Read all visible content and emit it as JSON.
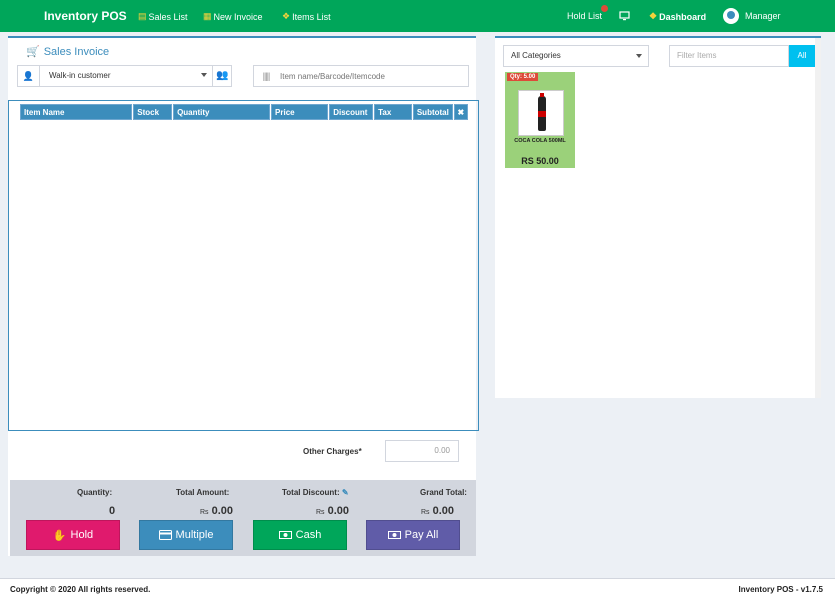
{
  "nav": {
    "brand": "Inventory POS",
    "sales_list": "Sales List",
    "new_invoice": "New Invoice",
    "items_list": "Items List",
    "hold_list": "Hold List",
    "dashboard": "Dashboard",
    "user": "Manager",
    "colors": {
      "bar": "#00a65a",
      "icon": "#f6d33c"
    }
  },
  "invoice": {
    "title": "Sales Invoice",
    "customer": "Walk-in customer",
    "search_placeholder": "Item name/Barcode/Itemcode",
    "columns": [
      "Item Name",
      "Stock",
      "Quantity",
      "Price",
      "Discount",
      "Tax",
      "Subtotal",
      "✖"
    ],
    "other_charges_label": "Other Charges*",
    "other_charges_value": "0.00"
  },
  "totals": {
    "quantity_label": "Quantity:",
    "quantity_value": "0",
    "total_amount_label": "Total Amount:",
    "total_amount_value": "0.00",
    "total_discount_label": "Total Discount:",
    "total_discount_value": "0.00",
    "grand_total_label": "Grand Total:",
    "grand_total_value": "0.00",
    "currency": "Rs"
  },
  "buttons": {
    "hold": "Hold",
    "multiple": "Multiple",
    "cash": "Cash",
    "pay_all": "Pay All"
  },
  "items_panel": {
    "category": "All Categories",
    "filter_placeholder": "Filter Items",
    "all_label": "All",
    "products": [
      {
        "qty": "Qty: 5.00",
        "name": "COCA COLA 500ML",
        "price": "RS 50.00"
      }
    ]
  },
  "footer": {
    "copyright": "Copyright © 2020 All rights reserved.",
    "version": "Inventory POS - v1.7.5"
  }
}
